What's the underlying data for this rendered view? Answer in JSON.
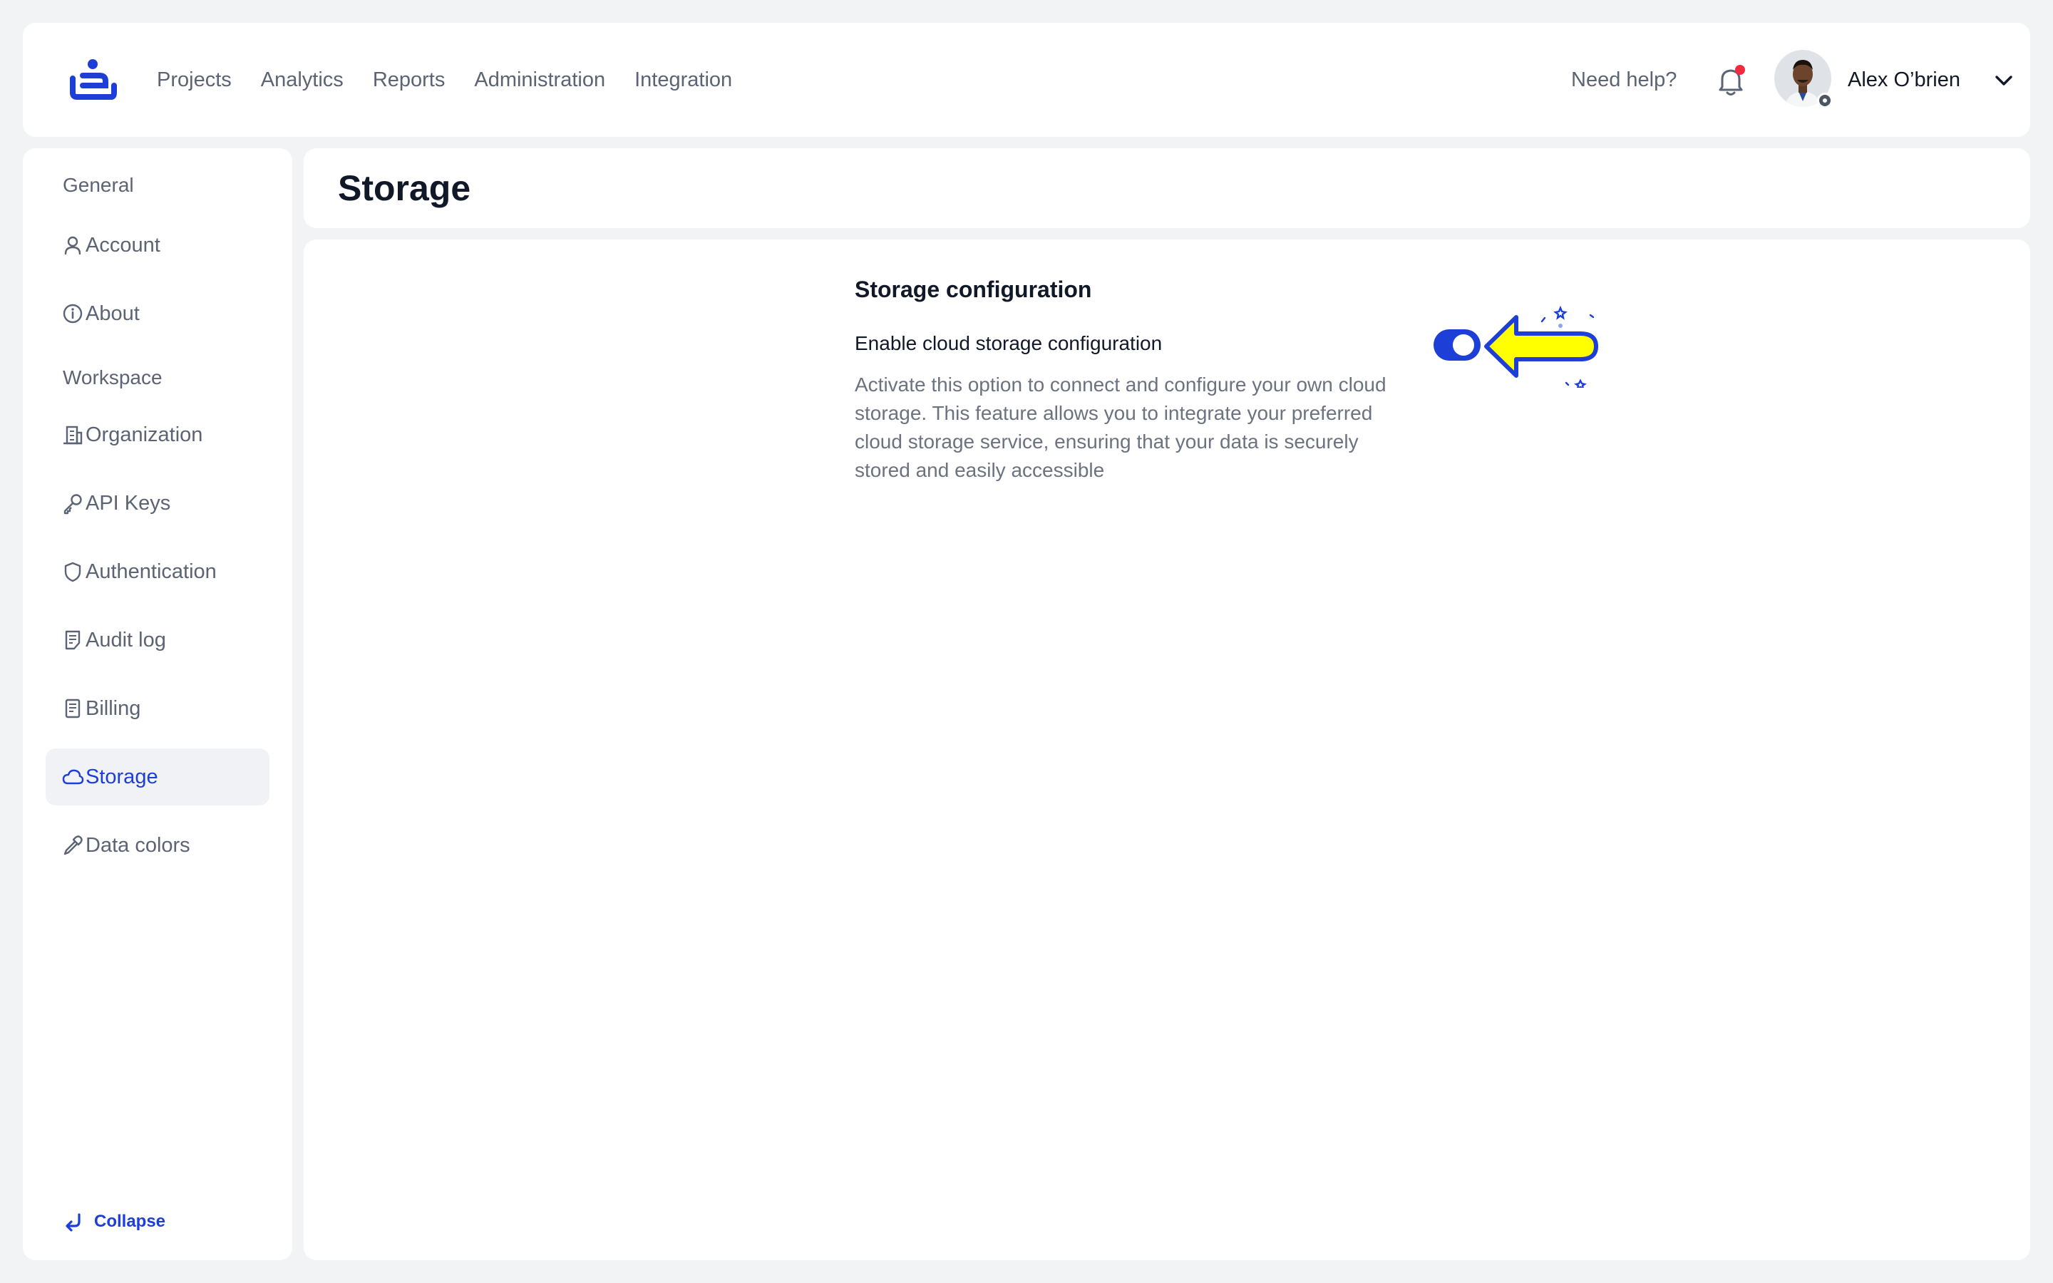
{
  "nav": {
    "items": [
      "Projects",
      "Analytics",
      "Reports",
      "Administration",
      "Integration"
    ],
    "help_label": "Need help?",
    "user_name": "Alex O’brien"
  },
  "sidebar": {
    "section_general": "General",
    "section_workspace": "Workspace",
    "items": [
      {
        "label": "Account",
        "icon": "user-icon"
      },
      {
        "label": "About",
        "icon": "info-icon"
      },
      {
        "label": "Organization",
        "icon": "building-icon"
      },
      {
        "label": "API Keys",
        "icon": "key-icon"
      },
      {
        "label": "Authentication",
        "icon": "shield-icon"
      },
      {
        "label": "Audit log",
        "icon": "document-list-icon"
      },
      {
        "label": "Billing",
        "icon": "receipt-icon"
      },
      {
        "label": "Storage",
        "icon": "cloud-icon",
        "active": true
      },
      {
        "label": "Data colors",
        "icon": "eyedropper-icon"
      }
    ],
    "collapse_label": "Collapse"
  },
  "page": {
    "title": "Storage"
  },
  "storage": {
    "section_title": "Storage configuration",
    "setting_label": "Enable cloud storage configuration",
    "setting_description": "Activate this option to connect and configure your own cloud storage. This feature allows you to integrate your preferred cloud storage service, ensuring that your data is securely stored and easily accessible",
    "toggle_on": true
  },
  "colors": {
    "accent": "#1d3fd8",
    "notification_dot": "#ef2b3d",
    "highlight_arrow": "#ffff00"
  }
}
